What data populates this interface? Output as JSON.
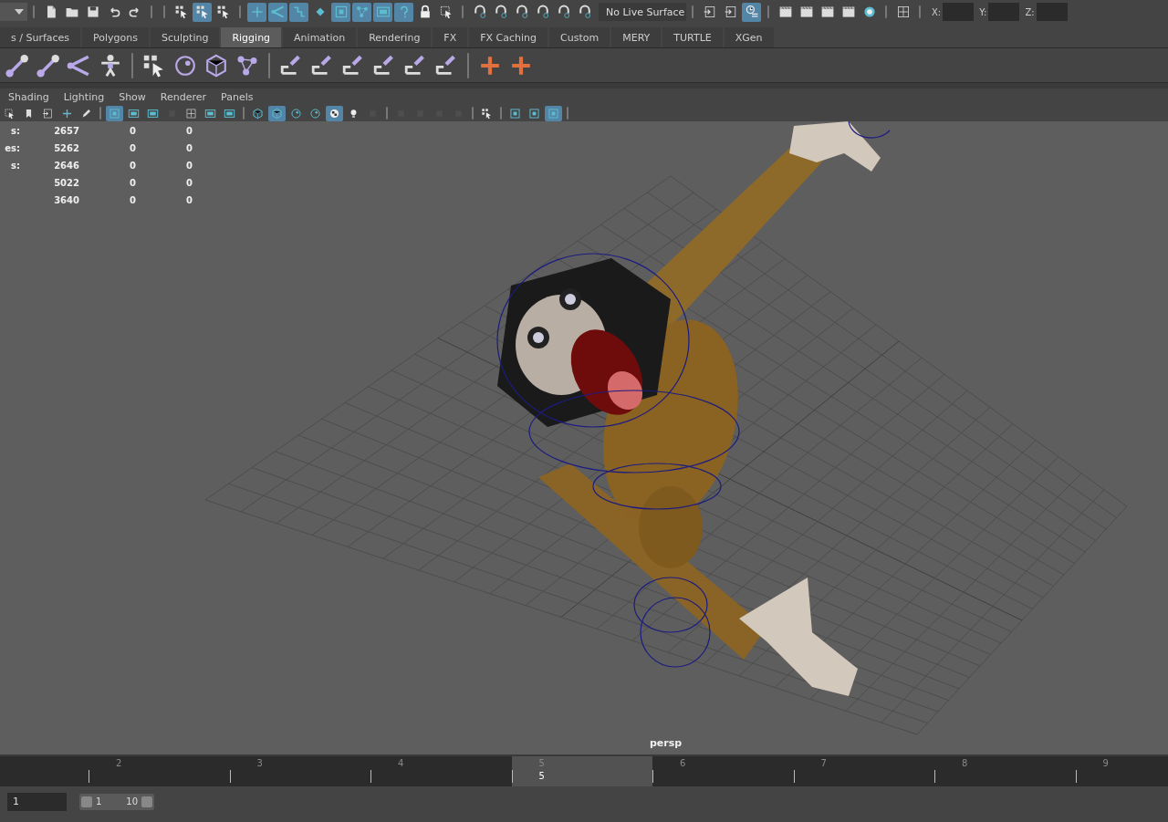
{
  "status_line": {
    "groups": [
      [
        {
          "selected": false
        },
        {
          "selected": false
        },
        {
          "selected": false
        },
        {
          "selected": false
        },
        {
          "selected": false
        }
      ],
      [
        {
          "selected": false
        },
        {
          "selected": true
        },
        {
          "selected": false
        }
      ],
      [
        {
          "selected": true
        },
        {
          "selected": true
        },
        {
          "selected": true
        },
        {
          "selected": false
        },
        {
          "selected": true
        },
        {
          "selected": true
        },
        {
          "selected": true
        },
        {
          "selected": true
        },
        {
          "selected": false
        },
        {
          "selected": false
        }
      ],
      [
        {
          "selected": false
        },
        {
          "selected": false
        },
        {
          "selected": false
        },
        {
          "selected": false
        },
        {
          "selected": false
        },
        {
          "selected": false
        }
      ],
      [
        {
          "selected": false
        },
        {
          "selected": false
        },
        {
          "selected": true
        }
      ],
      [
        {
          "selected": false
        },
        {
          "selected": false
        },
        {
          "selected": false
        },
        {
          "selected": false
        },
        {
          "selected": false
        }
      ],
      [
        {
          "selected": false
        }
      ]
    ],
    "live_surface": "No Live Surface",
    "coordinates": [
      {
        "label": "X:"
      },
      {
        "label": "Y:"
      },
      {
        "label": "Z:"
      }
    ]
  },
  "shelf_tabs": [
    {
      "label": "s / Surfaces",
      "selected": false
    },
    {
      "label": "Polygons",
      "selected": false
    },
    {
      "label": "Sculpting",
      "selected": false
    },
    {
      "label": "Rigging",
      "selected": true
    },
    {
      "label": "Animation",
      "selected": false
    },
    {
      "label": "Rendering",
      "selected": false
    },
    {
      "label": "FX",
      "selected": false
    },
    {
      "label": "FX Caching",
      "selected": false
    },
    {
      "label": "Custom",
      "selected": false
    },
    {
      "label": "MERY",
      "selected": false
    },
    {
      "label": "TURTLE",
      "selected": false
    },
    {
      "label": "XGen",
      "selected": false
    }
  ],
  "panel_menu": [
    "Shading",
    "Lighting",
    "Show",
    "Renderer",
    "Panels"
  ],
  "panel_toolbar": {
    "groups": [
      [
        {
          "selected": false
        },
        {
          "selected": false
        },
        {
          "selected": false
        },
        {
          "selected": false
        },
        {
          "selected": false
        }
      ],
      [
        {
          "selected": true
        },
        {
          "selected": false
        },
        {
          "selected": false
        },
        {
          "selected": false
        },
        {
          "selected": false
        },
        {
          "selected": false
        },
        {
          "selected": false
        }
      ],
      [
        {
          "selected": false
        },
        {
          "selected": true
        },
        {
          "selected": false
        },
        {
          "selected": false
        },
        {
          "selected": true
        },
        {
          "selected": false
        },
        {
          "selected": false
        }
      ],
      [
        {
          "selected": false
        },
        {
          "selected": false
        },
        {
          "selected": false
        },
        {
          "selected": false
        }
      ],
      [
        {
          "selected": false
        }
      ],
      [
        {
          "selected": false
        },
        {
          "selected": false
        },
        {
          "selected": true
        }
      ]
    ]
  },
  "heads_up_display": [
    {
      "label": "s:",
      "values": [
        "2657",
        "0",
        "0"
      ]
    },
    {
      "label": "es:",
      "values": [
        "5262",
        "0",
        "0"
      ]
    },
    {
      "label": "s:",
      "values": [
        "2646",
        "0",
        "0"
      ]
    },
    {
      "values": [
        "5022",
        "0",
        "0"
      ]
    },
    {
      "values": [
        "3640",
        "0",
        "0"
      ]
    }
  ],
  "camera_label": "persp",
  "time_slider": {
    "frames": [
      {
        "label": "2",
        "current": false
      },
      {
        "label": "3",
        "current": false
      },
      {
        "label": "4",
        "current": false
      },
      {
        "label": "5",
        "current": true
      },
      {
        "label": "6",
        "current": false
      },
      {
        "label": "7",
        "current": false
      },
      {
        "label": "8",
        "current": false
      },
      {
        "label": "9",
        "current": false
      }
    ],
    "current_frame": "5"
  },
  "range_slider": {
    "start_field": "1",
    "range_start": "1",
    "range_end": "10",
    "level": 1
  }
}
